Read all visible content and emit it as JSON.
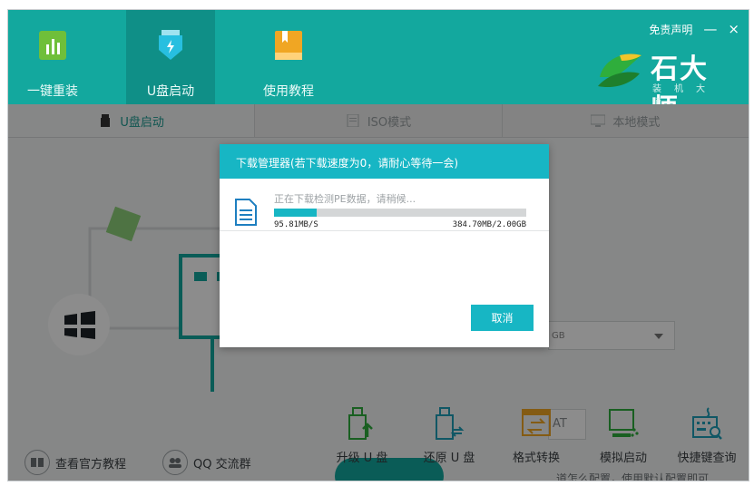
{
  "header": {
    "tabs": [
      {
        "label": "一键重装",
        "icon": "bar-chart-icon"
      },
      {
        "label": "U盘启动",
        "icon": "usb-shield-icon",
        "active": true
      },
      {
        "label": "使用教程",
        "icon": "bookmark-book-icon"
      }
    ],
    "disclaimer": "免责声明",
    "minimize": "—",
    "close": "×",
    "brand_name": "石大师",
    "brand_sub": "装机大师"
  },
  "modes": [
    {
      "label": "U盘启动",
      "icon": "usb-drive-icon",
      "active": true
    },
    {
      "label": "ISO模式",
      "icon": "document-icon"
    },
    {
      "label": "本地模式",
      "icon": "monitor-icon"
    }
  ],
  "options": {
    "select_value": "GB",
    "format_value": "AT",
    "hint": "道怎么配置，使用默认配置即可"
  },
  "bottom_links": [
    {
      "label": "查看官方教程",
      "icon": "book-icon"
    },
    {
      "label": "QQ 交流群",
      "icon": "group-icon"
    }
  ],
  "tools": [
    {
      "label": "升级 U 盘",
      "icon": "upgrade-usb-icon"
    },
    {
      "label": "还原 U 盘",
      "icon": "restore-usb-icon"
    },
    {
      "label": "格式转换",
      "icon": "format-convert-icon"
    },
    {
      "label": "模拟启动",
      "icon": "simulate-boot-icon"
    },
    {
      "label": "快捷键查询",
      "icon": "keyboard-search-icon"
    }
  ],
  "dialog": {
    "title": "下载管理器(若下载速度为0，请耐心等待一会)",
    "status": "正在下载检测PE数据，请稍候...",
    "progress": 0.17,
    "speed": "95.81MB/S",
    "size": "384.70MB/2.00GB",
    "cancel": "取消"
  },
  "colors": {
    "primary": "#13a89e",
    "dialog_accent": "#17b6c4",
    "orange": "#f0a623",
    "green": "#2fae3c"
  }
}
